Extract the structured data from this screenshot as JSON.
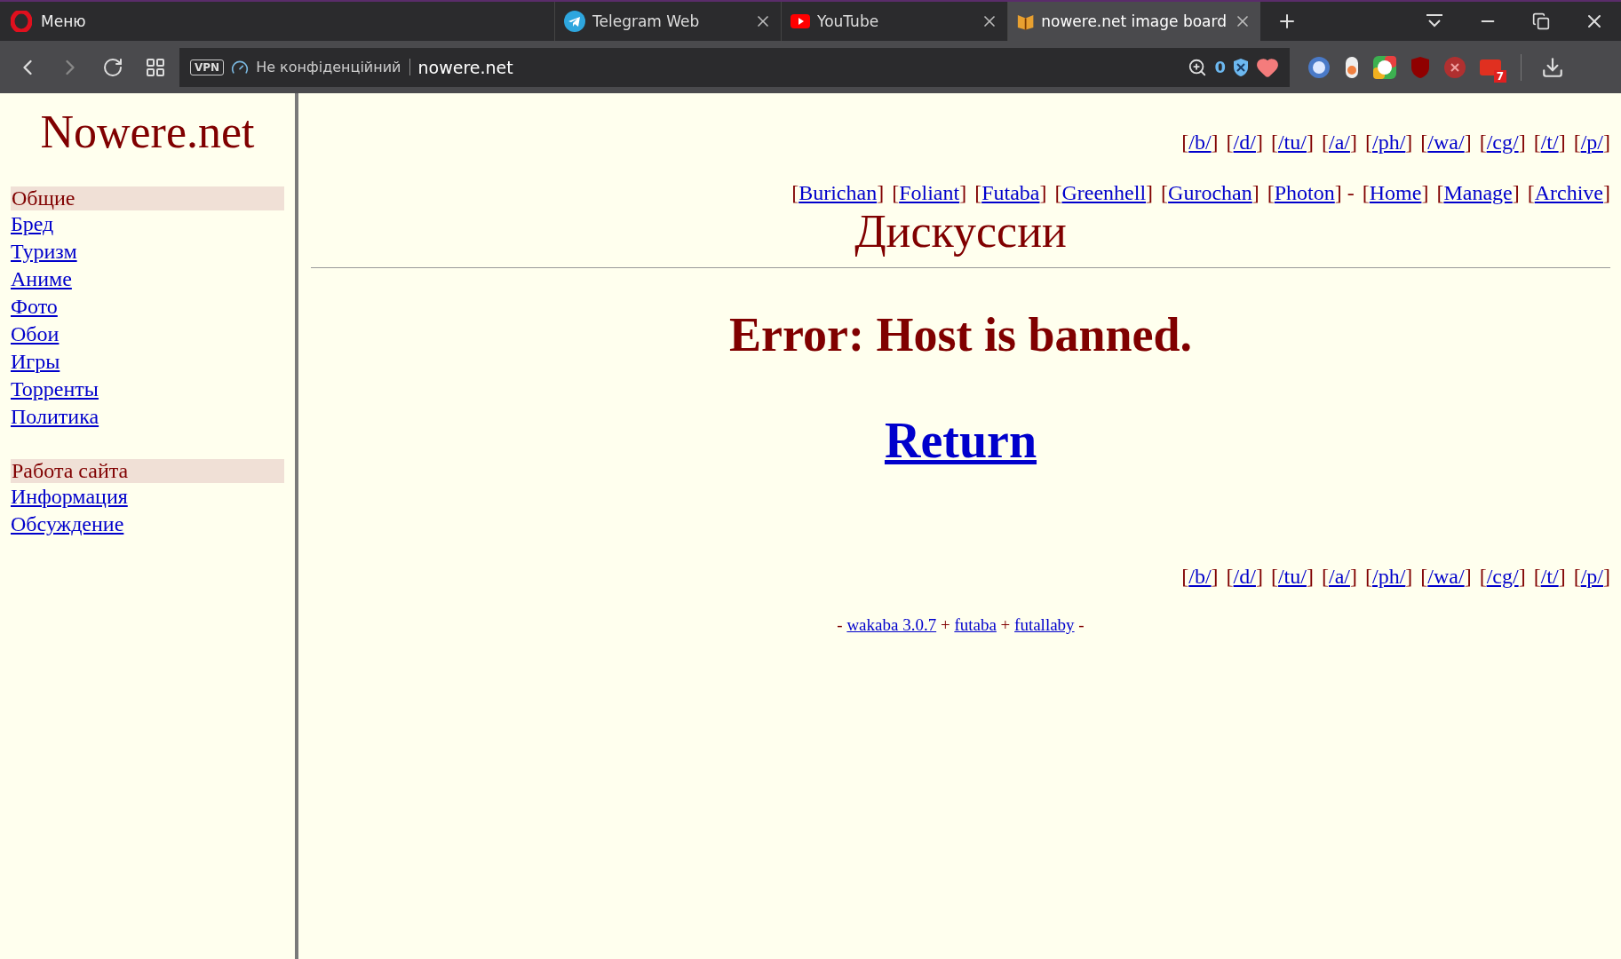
{
  "browser": {
    "menu_label": "Меню",
    "tabs": [
      {
        "title": "Telegram Web",
        "kind": "telegram",
        "selected": false
      },
      {
        "title": "YouTube",
        "kind": "youtube",
        "selected": false
      },
      {
        "title": "nowere.net image board",
        "kind": "board",
        "selected": true
      }
    ],
    "vpn_badge": "VPN",
    "security_label": "Не конфіденційний",
    "url": "nowere.net",
    "blocked_count": "0",
    "extension_badge": "7"
  },
  "sidebar": {
    "logo": "Nowere.net",
    "sections": [
      {
        "title": "Общие",
        "items": [
          "Бред",
          "Туризм",
          "Аниме",
          "Фото",
          "Обои",
          "Игры",
          "Торренты",
          "Политика"
        ]
      },
      {
        "title": "Работа сайта",
        "items": [
          "Информация",
          "Обсуждение"
        ]
      }
    ]
  },
  "board_nav": [
    {
      "before": "[",
      "link": "/b/",
      "after": "]"
    },
    {
      "before": "[",
      "link": "/d/",
      "after": "]"
    },
    {
      "before": "[",
      "link": "/tu/",
      "after": "]"
    },
    {
      "before": "[",
      "link": "/a/",
      "after": "]"
    },
    {
      "before": "[",
      "link": "/ph/",
      "after": "]"
    },
    {
      "before": "[",
      "link": "/wa/",
      "after": "]"
    },
    {
      "before": "[",
      "link": "/cg/",
      "after": "]"
    },
    {
      "before": "[",
      "link": "/t/",
      "after": "]"
    },
    {
      "before": "[",
      "link": "/p/",
      "after": "]"
    }
  ],
  "style_nav": [
    {
      "before": "[",
      "link": "Burichan",
      "after": "]"
    },
    {
      "before": "[",
      "link": "Foliant",
      "after": "]"
    },
    {
      "before": "[",
      "link": "Futaba",
      "after": "]"
    },
    {
      "before": "[",
      "link": "Greenhell",
      "after": "]"
    },
    {
      "before": "[",
      "link": "Gurochan",
      "after": "]"
    },
    {
      "before": "[",
      "link": "Photon",
      "after": "] -"
    },
    {
      "before": "[",
      "link": "Home",
      "after": "]"
    },
    {
      "before": "[",
      "link": "Manage",
      "after": "]"
    },
    {
      "before": "[",
      "link": "Archive",
      "after": "]"
    }
  ],
  "page_title": "Дискуссии",
  "error": "Error: Host is banned.",
  "return_link": "Return",
  "bottom_nav": [
    {
      "before": "[",
      "link": "/b/",
      "after": "]"
    },
    {
      "before": "[",
      "link": "/d/",
      "after": "]"
    },
    {
      "before": "[",
      "link": "/tu/",
      "after": "]"
    },
    {
      "before": "[",
      "link": "/a/",
      "after": "]"
    },
    {
      "before": "[",
      "link": "/ph/",
      "after": "]"
    },
    {
      "before": "[",
      "link": "/wa/",
      "after": "]"
    },
    {
      "before": "[",
      "link": "/cg/",
      "after": "]"
    },
    {
      "before": "[",
      "link": "/t/",
      "after": "]"
    },
    {
      "before": "[",
      "link": "/p/",
      "after": "]"
    }
  ],
  "footer": [
    {
      "before": "- ",
      "link": "wakaba 3.0.7"
    },
    {
      "before": " + ",
      "link": "futaba"
    },
    {
      "before": " + ",
      "link": "futallaby",
      "after": " -"
    }
  ]
}
